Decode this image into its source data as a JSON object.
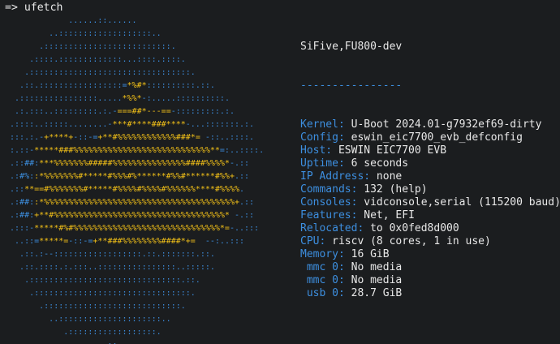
{
  "terminal": {
    "prompt": "=> ",
    "command": "ufetch"
  },
  "colors": {
    "background": "#1b1d1f",
    "key": "#3d8fe0",
    "text": "#e8e8e8",
    "logo_dots": "#3d8fe0",
    "logo_core": "#f2c018"
  },
  "logo": {
    "rows": [
      [
        {
          "t": "             ......::......",
          "c": "b"
        }
      ],
      [
        {
          "t": "         ..:::::::::::::::::::..",
          "c": "b"
        }
      ],
      [
        {
          "t": "       .::::::::::::::::::::::::::.",
          "c": "b"
        }
      ],
      [
        {
          "t": "     .::::.:::::::::::::...::::.::::.",
          "c": "b"
        }
      ],
      [
        {
          "t": "    .:::::::::::::::::::::::::::::::::.",
          "c": "b"
        }
      ],
      [
        {
          "t": "   .::.:::::::::::::::::=",
          "c": "b"
        },
        {
          "t": "*%#*",
          "c": "y"
        },
        {
          "t": "::::::::::.::.",
          "c": "b"
        }
      ],
      [
        {
          "t": "  .::::::::::::::::.....",
          "c": "b"
        },
        {
          "t": "*%%*",
          "c": "y"
        },
        {
          "t": "-:.....::::::::::.",
          "c": "b"
        }
      ],
      [
        {
          "t": "  .:.:::..:::::::::.:.-",
          "c": "b"
        },
        {
          "t": "===##*---==",
          "c": "y"
        },
        {
          "t": "-:::::::::.:.",
          "c": "b"
        }
      ],
      [
        {
          "t": " .::::..:::::........-",
          "c": "b"
        },
        {
          "t": "***#****###****",
          "c": "y"
        },
        {
          "t": "-...:::::::.:.",
          "c": "b"
        }
      ],
      [
        {
          "t": " :::.:.-",
          "c": "b"
        },
        {
          "t": "+****+",
          "c": "y"
        },
        {
          "t": "-::-=",
          "c": "b"
        },
        {
          "t": "+**#%%%%%%%%%%%%###*=",
          "c": "y"
        },
        {
          "t": " -::..::::.",
          "c": "b"
        }
      ],
      [
        {
          "t": " :.::-",
          "c": "b"
        },
        {
          "t": "*****###%%%%%%%%%%%%%%%%%%%%%%%%%%%%**",
          "c": "y"
        },
        {
          "t": "=:..::::.",
          "c": "b"
        }
      ],
      [
        {
          "t": " .::##:",
          "c": "b"
        },
        {
          "t": "***%%%%%%%#####%%%%%%%%%%%%%%%####%%%%*",
          "c": "y"
        },
        {
          "t": "-.::",
          "c": "b"
        }
      ],
      [
        {
          "t": " .:#%:",
          "c": "b"
        },
        {
          "t": ":*%%%%%%%#*****#%%%#%******#%%#******#%%+",
          "c": "y"
        },
        {
          "t": ".::",
          "c": "b"
        }
      ],
      [
        {
          "t": " .::",
          "c": "b"
        },
        {
          "t": "**==#%%%%%%%#*****#%%%%#%%%%#%%%%%%****#%%%%",
          "c": "y"
        },
        {
          "t": ".",
          "c": "b"
        }
      ],
      [
        {
          "t": " .:##:",
          "c": "b"
        },
        {
          "t": ":*%%%%%%%%%%%%%%%%%%%%%%%%%%%%%%%%%%%%%%%+",
          "c": "y"
        },
        {
          "t": ".::",
          "c": "b"
        }
      ],
      [
        {
          "t": " .:##:",
          "c": "b"
        },
        {
          "t": "+**#%%%%%%%%%%%%%%%%%%%%%%%%%%%%%%%%%%%*",
          "c": "y"
        },
        {
          "t": " -.::",
          "c": "b"
        }
      ],
      [
        {
          "t": " .:::-",
          "c": "b"
        },
        {
          "t": "*****#%#%%%%%%%%%%%%%%%%%%%%%%%%%%%%%%*=",
          "c": "y"
        },
        {
          "t": "-..:::",
          "c": "b"
        }
      ],
      [
        {
          "t": "  ..::=",
          "c": "b"
        },
        {
          "t": "*****=",
          "c": "y"
        },
        {
          "t": "-::-=",
          "c": "b"
        },
        {
          "t": "+**###%%%%%%%%####*+=",
          "c": "y"
        },
        {
          "t": "  --:..:::",
          "c": "b"
        }
      ],
      [
        {
          "t": "   .::.:--::::::::::::::::::.::.:::::::.::.",
          "c": "b"
        }
      ],
      [
        {
          "t": "   .::.::::.:.:::..::::::::::::::::..:::::.",
          "c": "b"
        }
      ],
      [
        {
          "t": "    .:::::::::::::::::::::::::::::::.::.",
          "c": "b"
        }
      ],
      [
        {
          "t": "     .::::::::::::::::::::::::::::::::.",
          "c": "b"
        }
      ],
      [
        {
          "t": "       .::::::::::::::::::::::::::::.",
          "c": "b"
        }
      ],
      [
        {
          "t": "         ..:::::::::::::::::::::..",
          "c": "b"
        }
      ],
      [
        {
          "t": "            .::::::::::::::::::.",
          "c": "b"
        }
      ],
      [
        {
          "t": "               ......::......",
          "c": "b"
        }
      ]
    ]
  },
  "info": {
    "host_title": "SiFive,FU800-dev",
    "separator": "----------------",
    "fields": [
      {
        "key": "Kernel:",
        "value": " U-Boot 2024.01-g7932ef69-dirty"
      },
      {
        "key": "Config:",
        "value": " eswin_eic7700_evb_defconfig"
      },
      {
        "key": "Host:",
        "value": " ESWIN EIC7700 EVB"
      },
      {
        "key": "Uptime:",
        "value": " 6 seconds"
      },
      {
        "key": "IP Address:",
        "value": " none"
      },
      {
        "key": "Commands:",
        "value": " 132 (help)"
      },
      {
        "key": "Consoles:",
        "value": " vidconsole,serial (115200 baud)"
      },
      {
        "key": "Features:",
        "value": " Net, EFI"
      },
      {
        "key": "Relocated:",
        "value": " to 0x0fed8d000"
      },
      {
        "key": "CPU:",
        "value": " riscv (8 cores, 1 in use)"
      },
      {
        "key": "Memory:",
        "value": " 16 GiB"
      },
      {
        "key": " mmc 0:",
        "value": " No media"
      },
      {
        "key": " mmc 0:",
        "value": " No media"
      },
      {
        "key": " usb 0:",
        "value": " 28.7 GiB"
      }
    ]
  }
}
